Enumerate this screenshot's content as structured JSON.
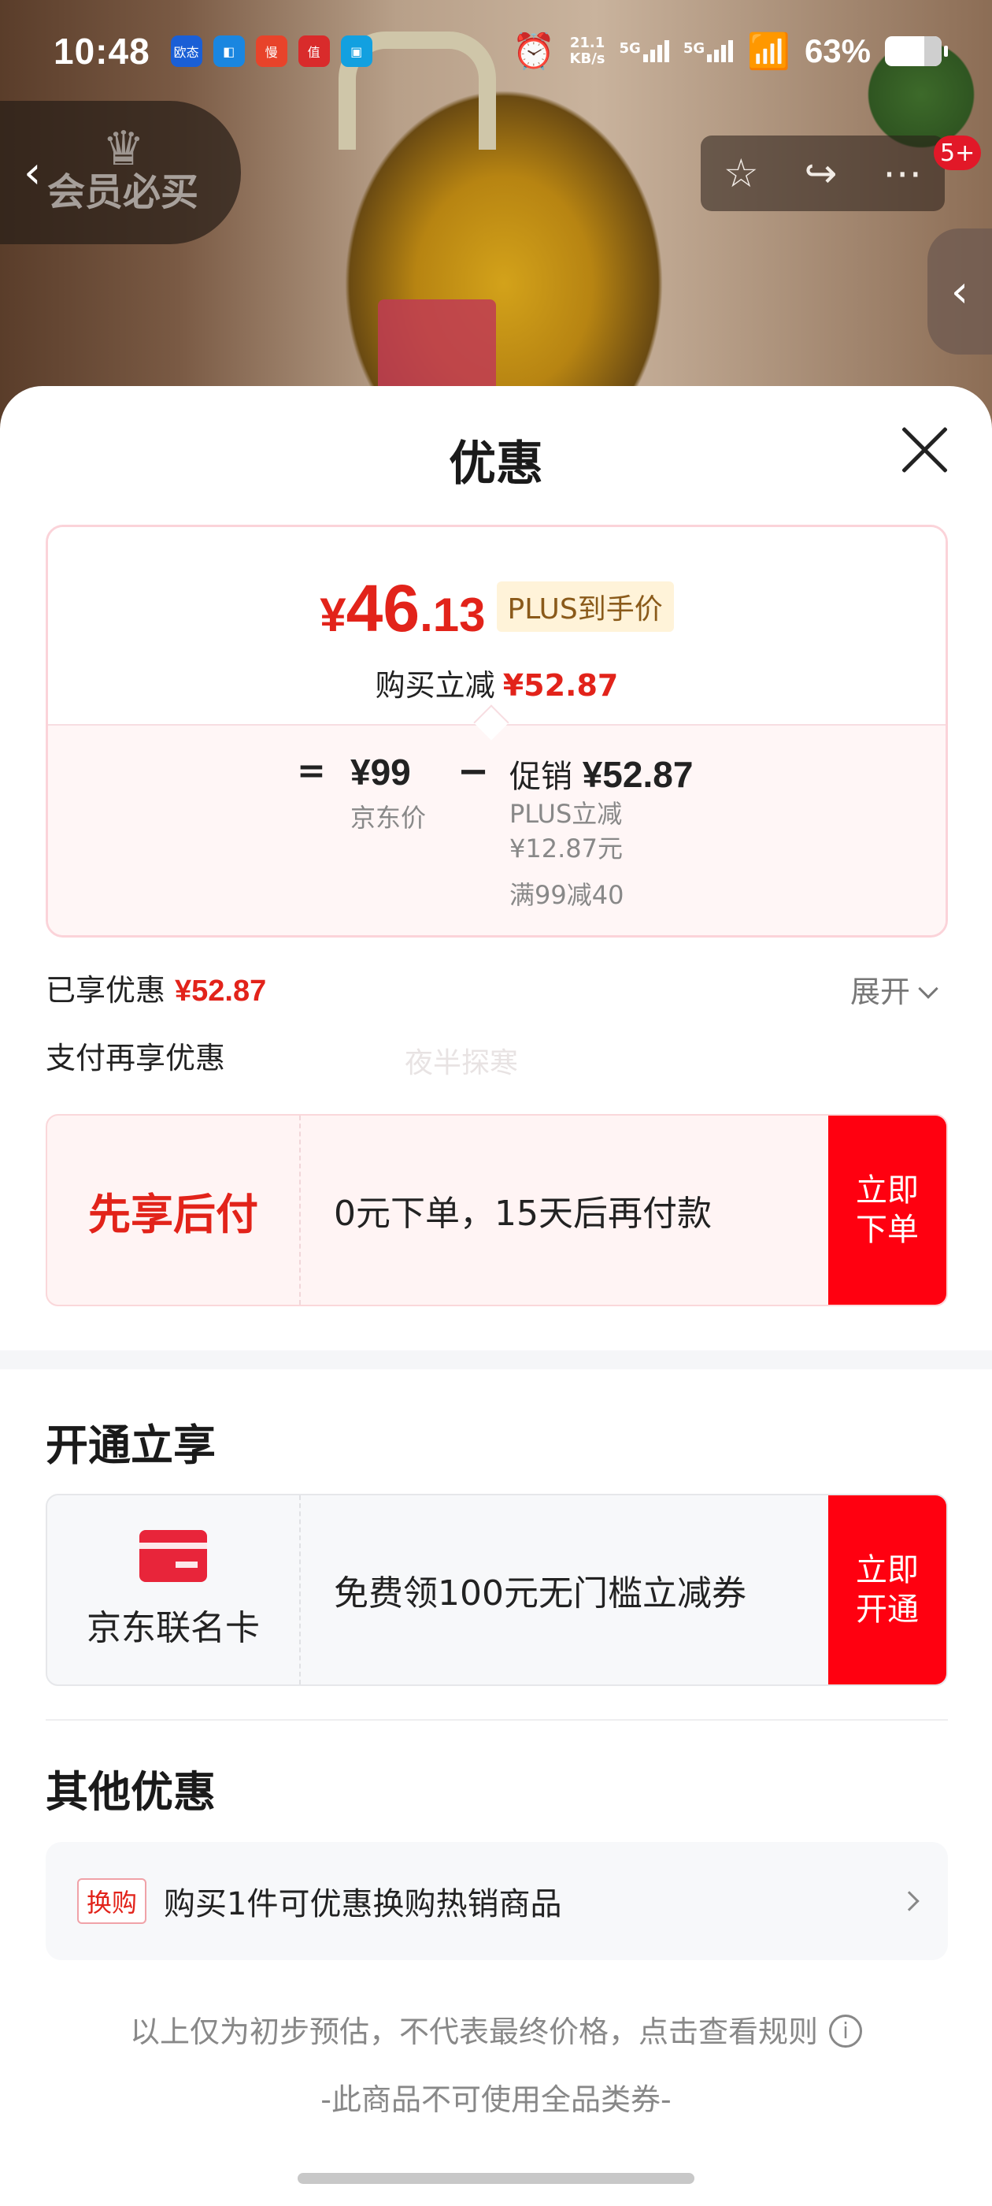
{
  "status_bar": {
    "time": "10:48",
    "apps": [
      "欧态",
      "◧",
      "慢",
      "值",
      "▣"
    ],
    "net_speed_value": "21.1",
    "net_speed_unit": "KB/s",
    "sig1": "5G",
    "sig2": "5G",
    "battery_pct": "63%"
  },
  "top_nav": {
    "back_icon": "‹",
    "member_label": "会员必买",
    "badge_count": "5+",
    "side_tab_icon": "‹"
  },
  "sheet": {
    "title": "优惠",
    "price_card": {
      "currency": "¥",
      "price_int": "46",
      "price_dec": ".13",
      "plus_tag": "PLUS到手价",
      "discount_label": "购买立减",
      "discount_value": "¥52.87",
      "eq": "=",
      "jd_price": "¥99",
      "jd_price_label": "京东价",
      "minus": "−",
      "promo_label": "促销",
      "promo_value": "¥52.87",
      "plus_reduce_label": "PLUS立减",
      "plus_reduce_value": "¥12.87元",
      "full_reduce": "满99减40"
    },
    "enjoyed_label": "已享优惠",
    "enjoyed_value": "¥52.87",
    "expand_label": "展开",
    "pay_more_label": "支付再享优惠",
    "watermark": "夜半探寒",
    "bnpl": {
      "title": "先享后付",
      "desc": "0元下单，15天后再付款",
      "button": "立即下单"
    },
    "open_section_title": "开通立享",
    "jd_card": {
      "label": "京东联名卡",
      "desc": "免费领100元无门槛立减券",
      "button": "立即开通"
    },
    "other_section_title": "其他优惠",
    "other_row": {
      "tag": "换购",
      "text": "购买1件可优惠换购热销商品"
    },
    "disclaimer": "以上仅为初步预估，不代表最终价格，点击查看规则",
    "disclaimer2": "-此商品不可使用全品类券-"
  }
}
